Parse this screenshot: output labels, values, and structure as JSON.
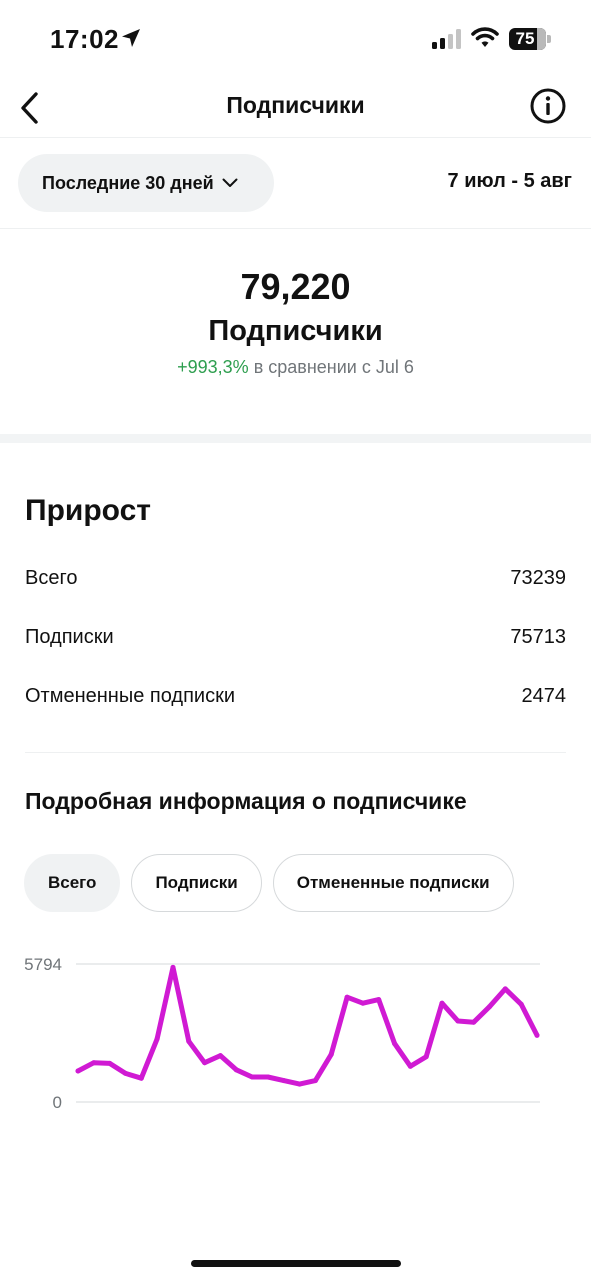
{
  "status": {
    "time": "17:02",
    "battery": "75"
  },
  "nav": {
    "title": "Подписчики"
  },
  "filter": {
    "period_label": "Последние 30 дней",
    "date_range": "7 июл - 5 авг"
  },
  "summary": {
    "total": "79,220",
    "label": "Подписчики",
    "change": "+993,3%",
    "compare_text": " в сравнении с Jul 6"
  },
  "growth": {
    "title": "Прирост",
    "rows": [
      {
        "label": "Всего",
        "value": "73239"
      },
      {
        "label": "Подписки",
        "value": "75713"
      },
      {
        "label": "Отмененные подписки",
        "value": "2474"
      }
    ]
  },
  "details": {
    "title": "Подробная информация о подписчике",
    "tabs": [
      {
        "label": "Всего",
        "active": true
      },
      {
        "label": "Подписки",
        "active": false
      },
      {
        "label": "Отмененные подписки",
        "active": false
      }
    ]
  },
  "colors": {
    "line": "#d01ad3",
    "positive": "#2e9e4f"
  },
  "chart_data": {
    "type": "line",
    "ylim": [
      0,
      5794
    ],
    "y_tick_labels": [
      "5794",
      "0"
    ],
    "x": [
      1,
      2,
      3,
      4,
      5,
      6,
      7,
      8,
      9,
      10,
      11,
      12,
      13,
      14,
      15,
      16,
      17,
      18,
      19,
      20,
      21,
      22,
      23,
      24,
      25,
      26,
      27,
      28,
      29,
      30
    ],
    "values": [
      1300,
      1650,
      1620,
      1200,
      1000,
      2650,
      5650,
      2550,
      1650,
      1950,
      1350,
      1050,
      1050,
      900,
      750,
      900,
      2000,
      4400,
      4150,
      4300,
      2450,
      1500,
      1900,
      4150,
      3400,
      3350,
      4000,
      4750,
      4100,
      2800
    ]
  }
}
